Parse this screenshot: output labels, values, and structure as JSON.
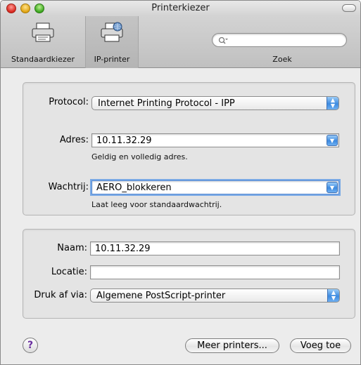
{
  "window": {
    "title": "Printerkiezer"
  },
  "toolbar": {
    "items": [
      {
        "label": "Standaardkiezer",
        "icon": "printer-icon"
      },
      {
        "label": "IP-printer",
        "icon": "network-printer-icon"
      }
    ],
    "search": {
      "label": "Zoek",
      "value": "",
      "placeholder": ""
    }
  },
  "connection": {
    "protocol": {
      "label": "Protocol:",
      "value": "Internet Printing Protocol - IPP"
    },
    "address": {
      "label": "Adres:",
      "value": "10.11.32.29",
      "hint": "Geldig en volledig adres."
    },
    "queue": {
      "label": "Wachtrij:",
      "value": "AERO_blokkeren",
      "hint": "Laat leeg voor standaardwachtrij."
    }
  },
  "printer": {
    "name": {
      "label": "Naam:",
      "value": "10.11.32.29"
    },
    "location": {
      "label": "Locatie:",
      "value": ""
    },
    "driver": {
      "label": "Druk af via:",
      "value": "Algemene PostScript-printer"
    }
  },
  "footer": {
    "help": "?",
    "more_printers": "Meer printers...",
    "add": "Voeg toe"
  },
  "colors": {
    "accent": "#3d8ae0",
    "focus_ring": "#79a9e5"
  }
}
